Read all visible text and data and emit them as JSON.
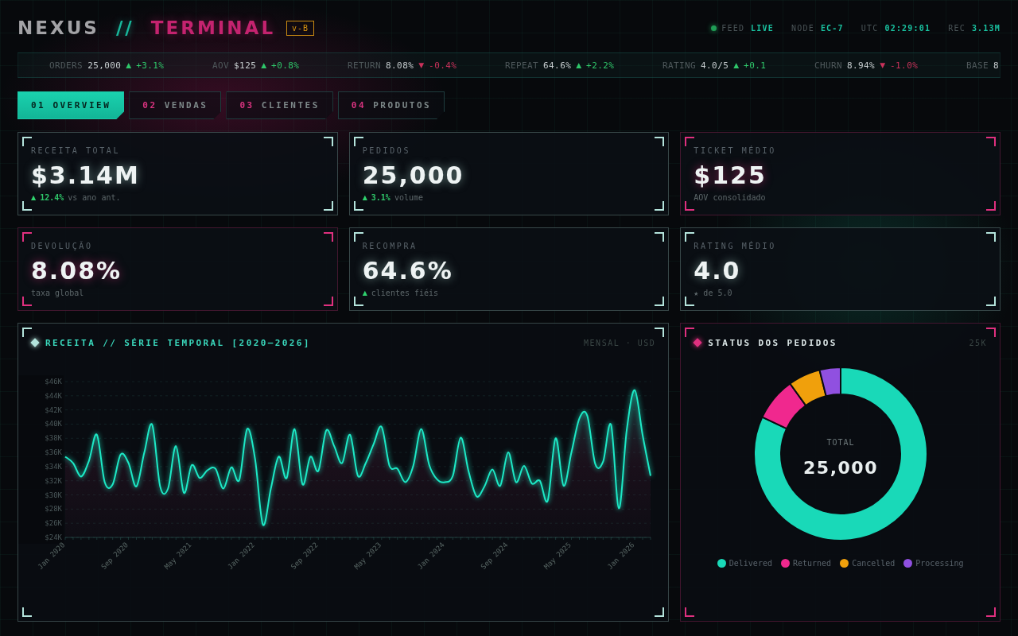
{
  "header": {
    "brand": {
      "primary": "NEXUS",
      "divider": "//",
      "secondary": "TERMINAL"
    },
    "version": "v-B",
    "status": [
      {
        "label": "FEED",
        "value": "LIVE",
        "indicator": true
      },
      {
        "label": "NODE",
        "value": "EC-7",
        "indicator": false
      },
      {
        "label": "UTC",
        "value": "02:29:01",
        "indicator": false
      },
      {
        "label": "REC",
        "value": "3.13M",
        "indicator": false
      }
    ]
  },
  "ticker": [
    {
      "label": "ORDERS",
      "value": "25,000",
      "arrow": "▲",
      "delta": "+3.1%",
      "color": "#2fc76a"
    },
    {
      "label": "AOV",
      "value": "$125",
      "arrow": "▲",
      "delta": "+0.8%",
      "color": "#2fc76a"
    },
    {
      "label": "RETURN",
      "value": "8.08%",
      "arrow": "▼",
      "delta": "-0.4%",
      "color": "#c9325b"
    },
    {
      "label": "REPEAT",
      "value": "64.6%",
      "arrow": "▲",
      "delta": "+2.2%",
      "color": "#2fc76a"
    },
    {
      "label": "RATING",
      "value": "4.0/5",
      "arrow": "▲",
      "delta": "+0.1",
      "color": "#2fc76a"
    },
    {
      "label": "CHURN",
      "value": "8.94%",
      "arrow": "▼",
      "delta": "-1.0%",
      "color": "#c9325b"
    },
    {
      "label": "BASE",
      "value": "8"
    }
  ],
  "tabs": [
    {
      "number": "01",
      "label": "OVERVIEW",
      "selected": true
    },
    {
      "number": "02",
      "label": "VENDAS",
      "selected": false
    },
    {
      "number": "03",
      "label": "CLIENTES",
      "selected": false
    },
    {
      "number": "04",
      "label": "PRODUTOS",
      "selected": false
    }
  ],
  "cards": [
    {
      "label": "RECEITA TOTAL",
      "value": "$3.14M",
      "color": "#b4e4dc",
      "arrow": "▲",
      "delta": "12.4%",
      "note": "vs ano ant."
    },
    {
      "label": "PEDIDOS",
      "value": "25,000",
      "color": "#b4e4dc",
      "arrow": "▲",
      "delta": "3.1%",
      "note": "volume"
    },
    {
      "label": "TICKET MÉDIO",
      "value": "$125",
      "color": "#e0307f",
      "note": "AOV consolidado"
    },
    {
      "label": "DEVOLUÇÃO",
      "value": "8.08%",
      "color": "#e0307f",
      "note": "taxa global"
    },
    {
      "label": "RECOMPRA",
      "value": "64.6%",
      "color": "#b4e4dc",
      "arrow": "▲",
      "note": "clientes fiéis"
    },
    {
      "label": "RATING MÉDIO",
      "value": "4.0",
      "color": "#b4e4dc",
      "note": "★ de 5.0"
    }
  ],
  "revenue_panel": {
    "title": "RECEITA // SÉRIE TEMPORAL [2020–2026]",
    "meta": "MENSAL · USD",
    "color": "#b4e4dc",
    "chart_data": {
      "type": "area",
      "grid": true,
      "ylim": [
        24,
        46
      ],
      "yticks": [
        {
          "value": 24,
          "label": "$24K"
        },
        {
          "value": 26,
          "label": "$26K"
        },
        {
          "value": 28,
          "label": "$28K"
        },
        {
          "value": 30,
          "label": "$30K"
        },
        {
          "value": 32,
          "label": "$32K"
        },
        {
          "value": 34,
          "label": "$34K"
        },
        {
          "value": 36,
          "label": "$36K"
        },
        {
          "value": 38,
          "label": "$38K"
        },
        {
          "value": 40,
          "label": "$40K"
        },
        {
          "value": 42,
          "label": "$42K"
        },
        {
          "value": 44,
          "label": "$44K"
        },
        {
          "value": 46,
          "label": "$46K"
        }
      ],
      "categories": [
        "Jan 2020",
        null,
        null,
        null,
        null,
        null,
        null,
        null,
        "Sep 2020",
        null,
        null,
        null,
        null,
        null,
        null,
        null,
        "May 2021",
        null,
        null,
        null,
        null,
        null,
        null,
        null,
        "Jan 2022",
        null,
        null,
        null,
        null,
        null,
        null,
        null,
        "Sep 2022",
        null,
        null,
        null,
        null,
        null,
        null,
        null,
        "May 2023",
        null,
        null,
        null,
        null,
        null,
        null,
        null,
        "Jan 2024",
        null,
        null,
        null,
        null,
        null,
        null,
        null,
        "Sep 2024",
        null,
        null,
        null,
        null,
        null,
        null,
        null,
        "May 2025",
        null,
        null,
        null,
        null,
        null,
        null,
        null,
        "Jan 2026",
        null,
        null
      ],
      "series": [
        {
          "color": "#1de9c6",
          "values": [
            35.4,
            34.5,
            32.6,
            34.8,
            38.5,
            31.8,
            31.5,
            35.7,
            34.5,
            31.2,
            36.0,
            39.9,
            31.2,
            30.9,
            36.9,
            30.3,
            34.2,
            32.4,
            33.5,
            33.7,
            30.9,
            33.9,
            32.1,
            39.3,
            35.1,
            25.8,
            30.9,
            35.4,
            32.4,
            39.3,
            31.5,
            35.4,
            33.4,
            39.1,
            36.9,
            34.5,
            38.5,
            32.7,
            34.5,
            37.2,
            39.6,
            34.1,
            33.7,
            31.8,
            34.1,
            39.3,
            34.3,
            32.2,
            31.8,
            32.7,
            38.1,
            33.3,
            29.8,
            31.2,
            33.6,
            31.3,
            36.0,
            31.8,
            34.1,
            31.6,
            32.0,
            29.2,
            38.0,
            31.3,
            36.0,
            40.8,
            41.2,
            34.4,
            34.7,
            39.9,
            28.1,
            39.3,
            44.8,
            38.4,
            32.7
          ]
        }
      ]
    }
  },
  "status_panel": {
    "title": "STATUS DOS PEDIDOS",
    "meta": "25K",
    "color": "#e0307f",
    "center_label": "TOTAL",
    "center_value": "25,000",
    "chart_data": {
      "type": "donut",
      "categories": [
        "Delivered",
        "Returned",
        "Cancelled",
        "Processing"
      ],
      "values": [
        82.0,
        8.08,
        6.0,
        3.92
      ],
      "colors": [
        "#19d9b8",
        "#f0288e",
        "#f0a00c",
        "#9050e0"
      ]
    }
  }
}
